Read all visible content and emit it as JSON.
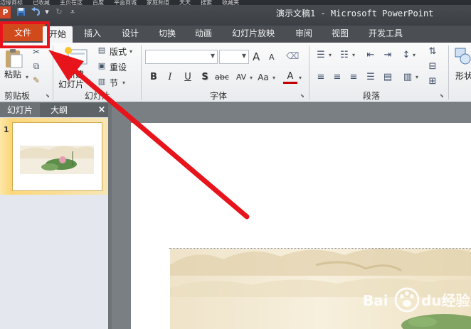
{
  "window": {
    "title": "演示文稿1 - Microsoft PowerPoint",
    "app_icon_letter": "P",
    "top_strip_items": [
      "边缘商标",
      "已收藏",
      "主页在这",
      "百度",
      "平面商城",
      "家庭频道",
      "天天",
      "搜索",
      "收藏夹"
    ]
  },
  "tabs": [
    "文件",
    "开始",
    "插入",
    "设计",
    "切换",
    "动画",
    "幻灯片放映",
    "审阅",
    "视图",
    "开发工具"
  ],
  "ribbon": {
    "clipboard": {
      "paste_label": "粘贴",
      "group_label": "剪贴板"
    },
    "slides": {
      "new_slide_label_line1": "新建",
      "new_slide_label_line2": "幻灯片",
      "layout_label": "版式",
      "reset_label": "重设",
      "section_label": "节",
      "group_label": "幻灯片"
    },
    "font": {
      "group_label": "字体",
      "bold": "B",
      "italic": "I",
      "underline": "U",
      "shadow": "S",
      "strike": "abc",
      "spacing": "AV",
      "case": "Aa",
      "grow": "A",
      "shrink": "A",
      "color": "A"
    },
    "paragraph": {
      "group_label": "段落"
    },
    "drawing": {
      "shapes_label": "形状"
    }
  },
  "left_pane": {
    "tab_slides": "幻灯片",
    "tab_outline": "大纲",
    "close_glyph": "×",
    "slide_number": "1"
  },
  "watermark": {
    "text": "Baidu经验"
  },
  "colors": {
    "file_tab": "#d04a1c",
    "annotation_red": "#e8141b",
    "selected_slide": "#fcd77a"
  }
}
